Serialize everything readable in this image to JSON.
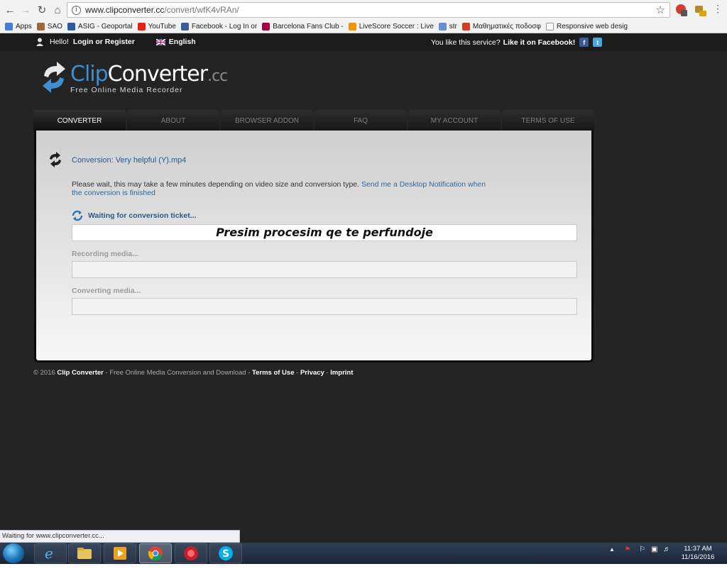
{
  "browser": {
    "url_host": "www.clipconverter.cc",
    "url_path": "/convert/wfK4vRAn/",
    "bookmarks": [
      {
        "label": "Apps",
        "color": "#4a7bd8"
      },
      {
        "label": "SAO",
        "color": "#9b6a3a"
      },
      {
        "label": "ASIG - Geoportal",
        "color": "#2c5aa0"
      },
      {
        "label": "YouTube",
        "color": "#e62117"
      },
      {
        "label": "Facebook - Log In or",
        "color": "#3b5998"
      },
      {
        "label": "Barcelona Fans Club -",
        "color": "#a50044"
      },
      {
        "label": "LiveScore Soccer : Live",
        "color": "#f29400"
      },
      {
        "label": "str",
        "color": "#6a8fd0"
      },
      {
        "label": "Μαθηματικές ποδοσφ",
        "color": "#d04020"
      },
      {
        "label": "Responsive web desig",
        "color": "#bbbbbb"
      }
    ],
    "status_text": "Waiting for www.clipconverter.cc..."
  },
  "site": {
    "greeting": "Hello!",
    "login_label": "Login or Register",
    "language": "English",
    "like_text": "You like this service?",
    "like_cta": "Like it on Facebook!",
    "logo_clip": "Clip",
    "logo_converter": "Converter",
    "logo_cc": ".cc",
    "tagline": "Free Online Media Recorder",
    "tabs": [
      "CONVERTER",
      "ABOUT",
      "BROWSER ADDON",
      "FAQ",
      "MY ACCOUNT",
      "TERMS OF USE"
    ],
    "active_tab": "CONVERTER"
  },
  "conversion": {
    "title": "Conversion: Very helpful (Y).mp4",
    "notice": "Please wait, this may take a few minutes depending on video size and conversion type.",
    "notify_link": "Send me a Desktop Notification when the conversion is finished",
    "status": "Waiting for conversion ticket...",
    "overlay_message": "Presim procesim qe te perfundoje",
    "recording_label": "Recording media...",
    "converting_label": "Converting media..."
  },
  "footer": {
    "copyright": "© 2016",
    "brand": "Clip Converter",
    "desc": " - Free Online Media Conversion and Download - ",
    "terms": "Terms of Use",
    "sep": " - ",
    "privacy": "Privacy",
    "imprint": "Imprint"
  },
  "taskbar": {
    "time": "11:37 AM",
    "date": "11/16/2016"
  }
}
